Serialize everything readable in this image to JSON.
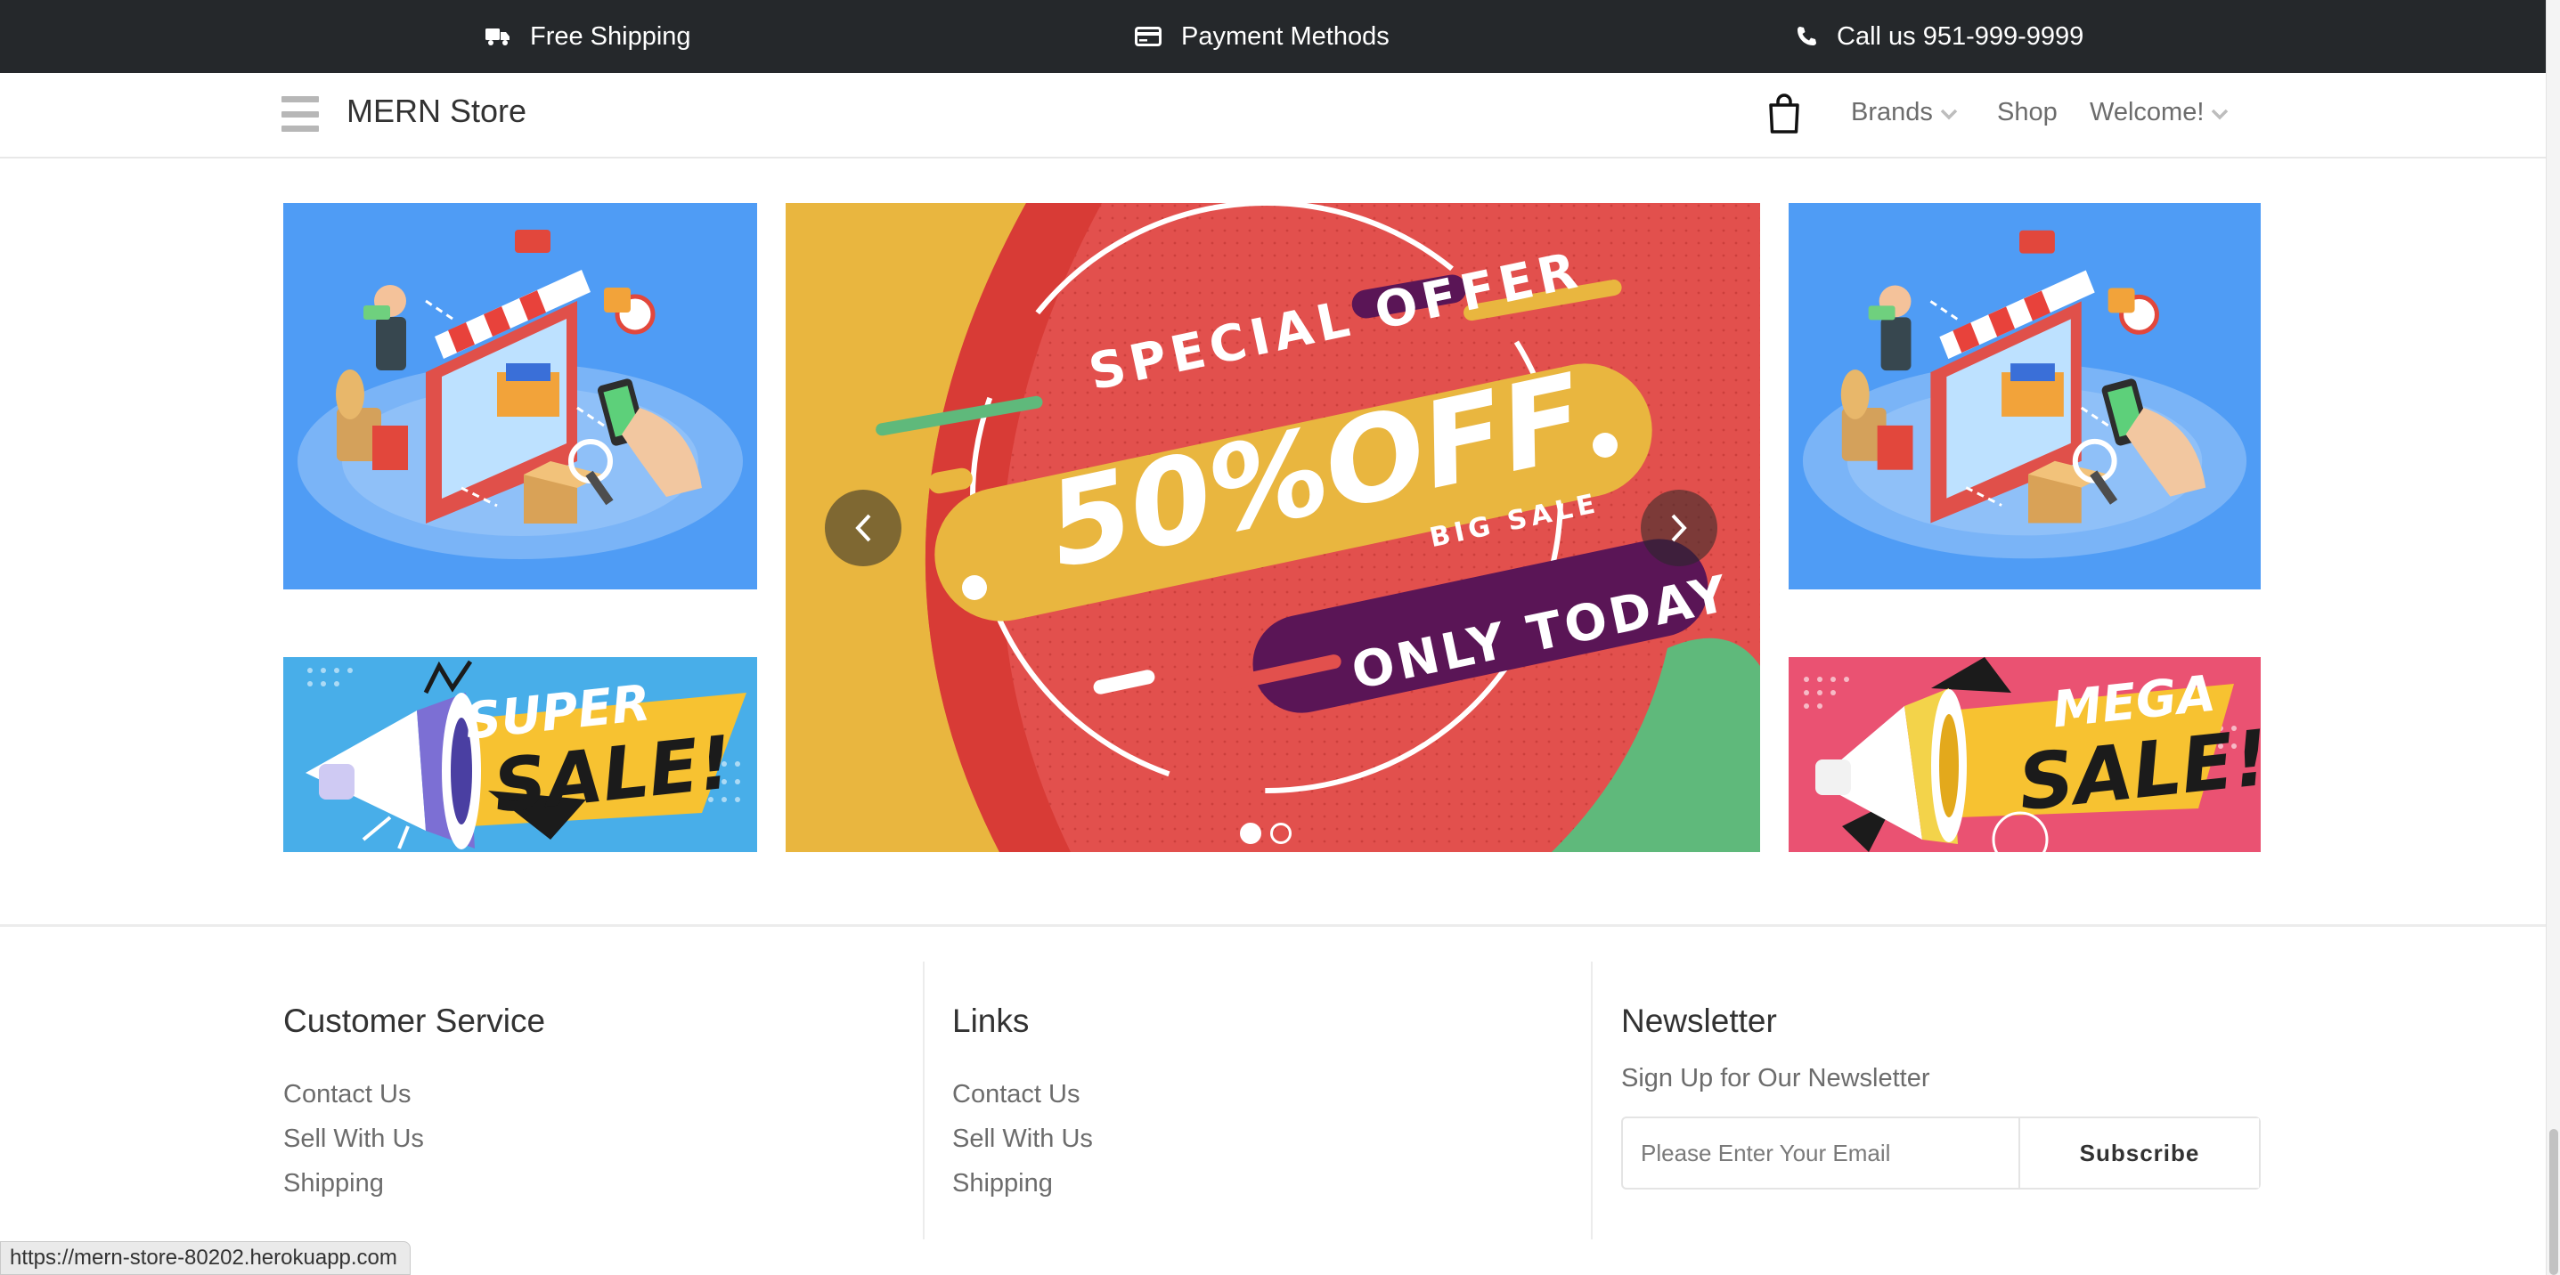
{
  "topbar": {
    "shipping": "Free Shipping",
    "payment": "Payment Methods",
    "call": "Call us 951-999-9999"
  },
  "header": {
    "brand": "MERN Store",
    "nav": {
      "brands": "Brands",
      "shop": "Shop",
      "welcome": "Welcome!"
    }
  },
  "banners": {
    "left_bottom": {
      "line1": "SUPER",
      "line2": "SALE!"
    },
    "right_bottom": {
      "line1": "MEGA",
      "line2": "SALE!"
    },
    "carousel": {
      "headline": "SPECIAL OFFER",
      "discount": "50%OFF",
      "tag": "BIG SALE",
      "cta": "ONLY TODAY",
      "active_slide": 1,
      "slide_count": 2
    }
  },
  "footer": {
    "customer_service": {
      "title": "Customer Service",
      "links": [
        "Contact Us",
        "Sell With Us",
        "Shipping"
      ]
    },
    "links": {
      "title": "Links",
      "links": [
        "Contact Us",
        "Sell With Us",
        "Shipping"
      ]
    },
    "newsletter": {
      "title": "Newsletter",
      "subtitle": "Sign Up for Our Newsletter",
      "placeholder": "Please Enter Your Email",
      "button": "Subscribe"
    }
  },
  "status_bar": {
    "url": "https://mern-store-80202.herokuapp.com"
  }
}
